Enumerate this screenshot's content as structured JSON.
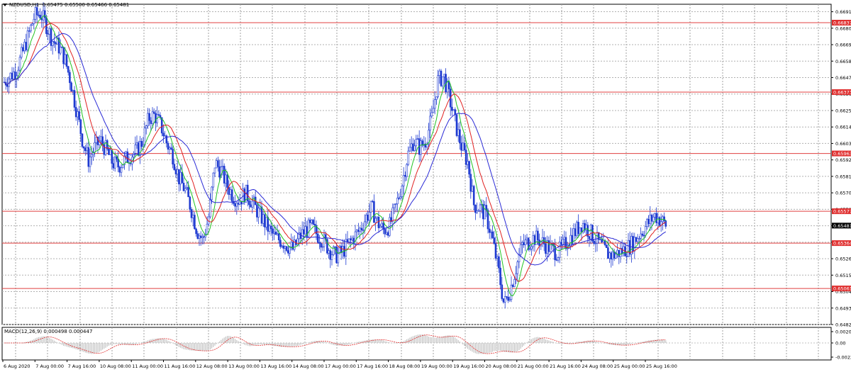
{
  "chart_header": {
    "symbol_tf": "NZDUSD,H1",
    "ohlc": "0.65475 0.65500 0.65466 0.65481"
  },
  "macd_label": "MACD(12,26,9) 0.000498 0.000447",
  "colors": {
    "candle": "#1f3bd1",
    "ma_fast": "#22c322",
    "ma_mid": "#e02020",
    "ma_slow": "#2b2bd6",
    "level_line": "#e04040",
    "macd_hist": "#b7b7b7",
    "macd_signal": "#e03030",
    "price_tag": "#e03030",
    "current_tag": "#000000"
  },
  "chart_data": {
    "type": "candlestick",
    "price_axis_ticks": [
      "0.66910",
      "0.66800",
      "0.66690",
      "0.66580",
      "0.66470",
      "0.66360",
      "0.66250",
      "0.66140",
      "0.66030",
      "0.65920",
      "0.65810",
      "0.65700",
      "0.65590",
      "0.65480",
      "0.65370",
      "0.65260",
      "0.65150",
      "0.65040",
      "0.64930",
      "0.64820"
    ],
    "price_range": [
      0.6482,
      0.6696
    ],
    "horizontal_levels": [
      "0.66837",
      "0.66373",
      "0.65963",
      "0.65577",
      "0.65364",
      "0.65061"
    ],
    "current_price": "0.65481",
    "time_axis_labels": [
      "6 Aug 2020",
      "7 Aug 00:00",
      "7 Aug 16:00",
      "10 Aug 08:00",
      "11 Aug 00:00",
      "11 Aug 16:00",
      "12 Aug 08:00",
      "13 Aug 00:00",
      "13 Aug 16:00",
      "14 Aug 08:00",
      "17 Aug 00:00",
      "17 Aug 16:00",
      "18 Aug 08:00",
      "19 Aug 00:00",
      "19 Aug 16:00",
      "20 Aug 08:00",
      "21 Aug 00:00",
      "21 Aug 16:00",
      "24 Aug 08:00",
      "25 Aug 00:00",
      "25 Aug 16:00"
    ],
    "macd_axis_ticks": [
      "0.002015",
      "0.00",
      "-0.002258"
    ],
    "price_path": [
      0.6644,
      0.6648,
      0.6652,
      0.6663,
      0.6675,
      0.6688,
      0.669,
      0.6682,
      0.6672,
      0.6668,
      0.666,
      0.6645,
      0.6625,
      0.6605,
      0.6592,
      0.66,
      0.6605,
      0.6598,
      0.659,
      0.6588,
      0.6592,
      0.6595,
      0.6598,
      0.6605,
      0.662,
      0.6622,
      0.6615,
      0.6603,
      0.6595,
      0.658,
      0.6572,
      0.656,
      0.6545,
      0.6538,
      0.6555,
      0.659,
      0.6585,
      0.6575,
      0.6568,
      0.6565,
      0.657,
      0.6565,
      0.6558,
      0.6552,
      0.6545,
      0.654,
      0.6538,
      0.6535,
      0.6532,
      0.654,
      0.6545,
      0.6547,
      0.6542,
      0.6538,
      0.6532,
      0.6528,
      0.653,
      0.6535,
      0.654,
      0.6545,
      0.6553,
      0.656,
      0.655,
      0.6545,
      0.6548,
      0.656,
      0.6575,
      0.6595,
      0.6605,
      0.66,
      0.6605,
      0.662,
      0.6645,
      0.6648,
      0.6632,
      0.6615,
      0.66,
      0.659,
      0.6562,
      0.656,
      0.6555,
      0.654,
      0.652,
      0.6495,
      0.6505,
      0.652,
      0.6535,
      0.6537,
      0.654,
      0.6538,
      0.6535,
      0.6532,
      0.653,
      0.6535,
      0.654,
      0.6545,
      0.655,
      0.6545,
      0.654,
      0.6535,
      0.653,
      0.6528,
      0.653,
      0.6532,
      0.6535,
      0.654,
      0.6545,
      0.655,
      0.6555,
      0.6552,
      0.6548
    ]
  }
}
